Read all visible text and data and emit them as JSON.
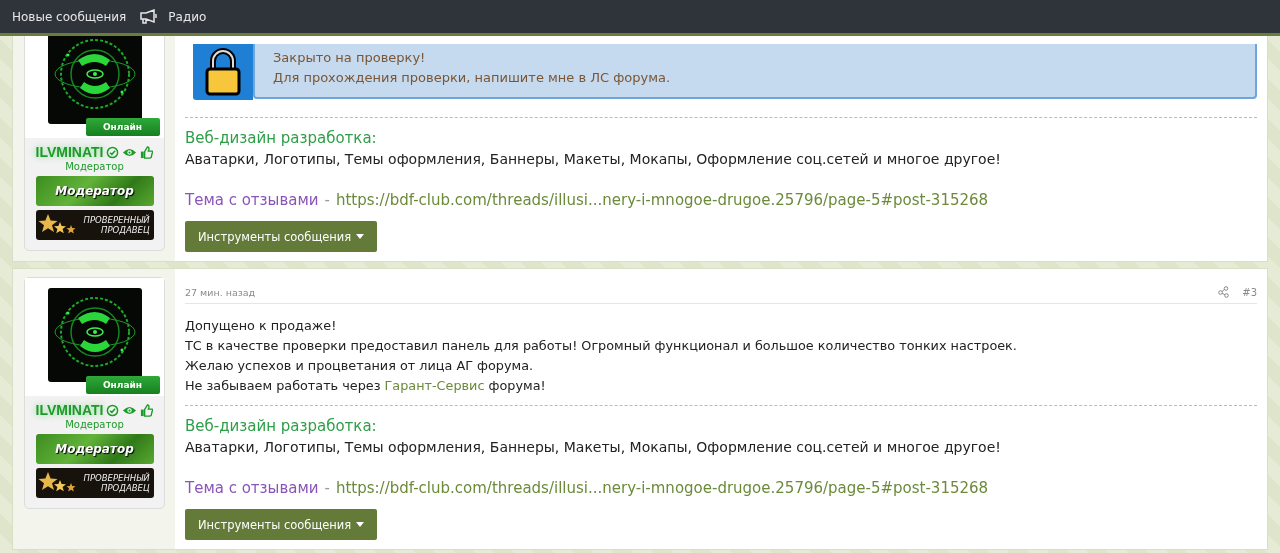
{
  "top_bar": {
    "items": [
      {
        "kind": "text",
        "label": "Новые сообщения"
      },
      {
        "kind": "megaphone",
        "label": "Радио"
      }
    ]
  },
  "posts": [
    {
      "author": {
        "status": "Онлайн",
        "online": true,
        "name": "ILVMINATI",
        "title": "Модератор",
        "banners": [
          {
            "kind": "moderator",
            "label": "Модератор"
          },
          {
            "kind": "seller",
            "lines": [
              "ПРОВЕРЕННЫЙ",
              "ПРОДАВЕЦ"
            ]
          }
        ]
      },
      "notice": {
        "lines": [
          "Закрыто на проверку!",
          "Для прохождения проверки, напишите мне в ЛС форума."
        ]
      },
      "signature": {
        "title": "Веб-дизайн разработка:",
        "text": "Аватарки, Логотипы, Темы оформления, Баннеры, Макеты, Мокапы, Оформление соц.сетей и многое другое!",
        "review_label": "Тема с отзывами",
        "separator": "-",
        "url": "https://bdf-club.com/threads/illusi...nery-i-mnogoe-drugoe.25796/page-5#post-315268"
      },
      "tools_button": "Инструменты сообщения"
    },
    {
      "time": "27 мин. назад",
      "number": "#3",
      "author": {
        "status": "Онлайн",
        "online": true,
        "name": "ILVMINATI",
        "title": "Модератор",
        "banners": [
          {
            "kind": "moderator",
            "label": "Модератор"
          },
          {
            "kind": "seller",
            "lines": [
              "ПРОВЕРЕННЫЙ",
              "ПРОДАВЕЦ"
            ]
          }
        ]
      },
      "body": [
        {
          "text": "Допущено к продаже!"
        },
        {
          "text": "ТС в качестве проверки предоставил панель для работы! Огромный функционал и большое количество тонких настроек."
        },
        {
          "text": "Желаю успехов и процветания от лица АГ форума."
        },
        {
          "text": "Не забываем работать через ",
          "link": "Гарант-Сервис",
          "after": " форума!"
        }
      ],
      "signature": {
        "title": "Веб-дизайн разработка:",
        "text": "Аватарки, Логотипы, Темы оформления, Баннеры, Макеты, Мокапы, Оформление соц.сетей и многое другое!",
        "review_label": "Тема с отзывами",
        "separator": "-",
        "url": "https://bdf-club.com/threads/illusi...nery-i-mnogoe-drugoe.25796/page-5#post-315268"
      },
      "tools_button": "Инструменты сообщения"
    }
  ]
}
